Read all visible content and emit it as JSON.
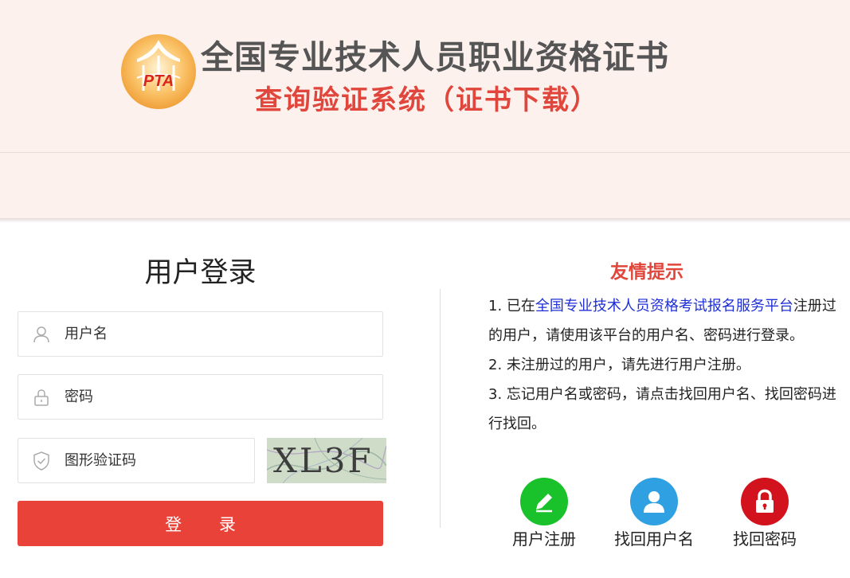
{
  "header": {
    "logo_text": "PTA",
    "title": "全国专业技术人员职业资格证书",
    "subtitle": "查询验证系统（证书下载）"
  },
  "login": {
    "title": "用户登录",
    "username_placeholder": "用户名",
    "password_placeholder": "密码",
    "captcha_placeholder": "图形验证码",
    "captcha_text": "XL3F",
    "submit_label": "登 录"
  },
  "tips": {
    "title": "友情提示",
    "item1_prefix": "1. 已在",
    "item1_link": "全国专业技术人员资格考试报名服务平台",
    "item1_suffix": "注册过的用户，请使用该平台的用户名、密码进行登录。",
    "item2": "2. 未注册过的用户，请先进行用户注册。",
    "item3": "3. 忘记用户名或密码，请点击找回用户名、找回密码进行找回。"
  },
  "actions": [
    {
      "label": "用户注册",
      "icon": "pencil-icon",
      "color": "#19c12b"
    },
    {
      "label": "找回用户名",
      "icon": "user-icon",
      "color": "#2fa0e1"
    },
    {
      "label": "找回密码",
      "icon": "lock-icon",
      "color": "#d2121c"
    }
  ],
  "colors": {
    "accent": "#e94238",
    "header_bg": "#fdf1ee",
    "link": "#1f2fd6"
  }
}
